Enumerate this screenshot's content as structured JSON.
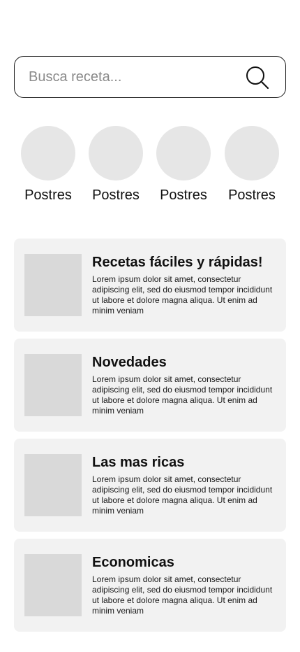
{
  "search": {
    "placeholder": "Busca receta..."
  },
  "categories": [
    {
      "label": "Postres"
    },
    {
      "label": "Postres"
    },
    {
      "label": "Postres"
    },
    {
      "label": "Postres"
    }
  ],
  "cards": [
    {
      "title": "Recetas fáciles y rápidas!",
      "text": "Lorem ipsum dolor sit amet, consectetur adipiscing elit, sed do eiusmod tempor incididunt ut labore et dolore magna aliqua. Ut enim ad minim veniam"
    },
    {
      "title": "Novedades",
      "text": "Lorem ipsum dolor sit amet, consectetur adipiscing elit, sed do eiusmod tempor incididunt ut labore et dolore magna aliqua. Ut enim ad minim veniam"
    },
    {
      "title": "Las mas ricas",
      "text": "Lorem ipsum dolor sit amet, consectetur adipiscing elit, sed do eiusmod tempor incididunt ut labore et dolore magna aliqua. Ut enim ad minim veniam"
    },
    {
      "title": "Economicas",
      "text": "Lorem ipsum dolor sit amet, consectetur adipiscing elit, sed do eiusmod tempor incididunt ut labore et dolore magna aliqua. Ut enim ad minim veniam"
    }
  ],
  "icons": {
    "search": "search-icon"
  }
}
